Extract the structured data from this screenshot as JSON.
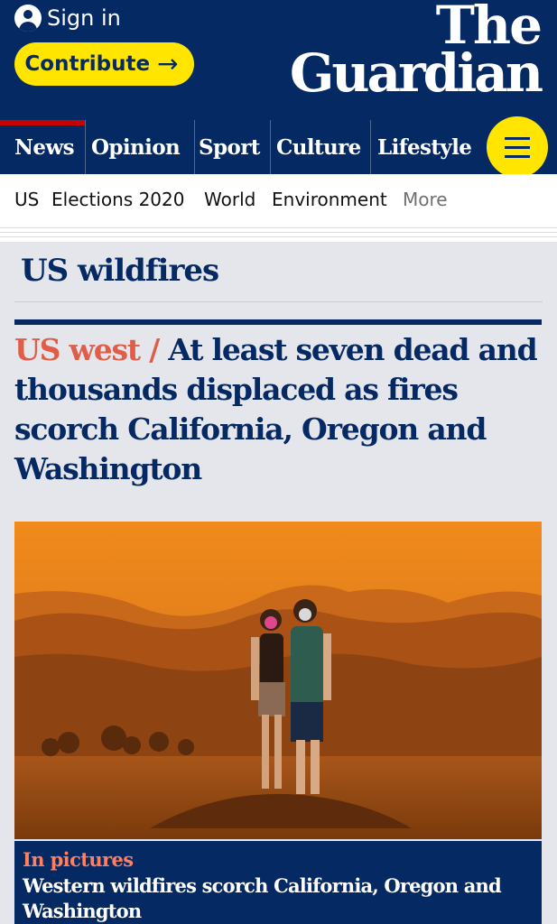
{
  "header": {
    "sign_in_label": "Sign in",
    "contribute_label": "Contribute",
    "logo_line1": "The",
    "logo_line2": "Guardian",
    "brand_color": "#052962",
    "accent_color": "#ffe500"
  },
  "nav": {
    "pillars": [
      {
        "label": "News",
        "active": true
      },
      {
        "label": "Opinion",
        "active": false
      },
      {
        "label": "Sport",
        "active": false
      },
      {
        "label": "Culture",
        "active": false
      },
      {
        "label": "Lifestyle",
        "active": false
      }
    ],
    "menu_icon": "hamburger-menu-icon"
  },
  "subnav": {
    "links": [
      "US",
      "Elections 2020",
      "World",
      "Environment"
    ],
    "more_label": "More"
  },
  "section": {
    "title": "US wildfires"
  },
  "main_story": {
    "kicker": "US west /",
    "headline": "At least seven dead and thousands displaced as fires scorch California, Oregon and Washington",
    "kicker_color": "#e05e48"
  },
  "gallery": {
    "kicker": "In pictures",
    "headline": "Western wildfires scorch California, Oregon and Washington",
    "kicker_color": "#ff7f5f"
  }
}
